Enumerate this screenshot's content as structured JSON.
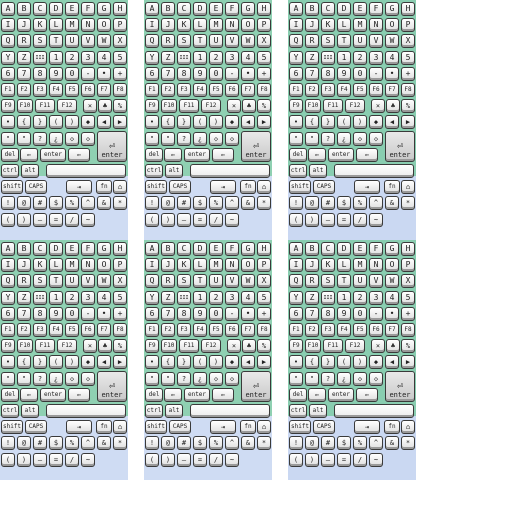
{
  "sheets": [
    {
      "id": "sheet-1",
      "variant": "a"
    },
    {
      "id": "sheet-2",
      "variant": "a"
    },
    {
      "id": "sheet-3",
      "variant": "b"
    },
    {
      "id": "sheet-4",
      "variant": "a"
    },
    {
      "id": "sheet-5",
      "variant": "a"
    },
    {
      "id": "sheet-6",
      "variant": "b"
    }
  ],
  "rows": [
    {
      "name": "letters-a-h",
      "keys": [
        "A",
        "B",
        "C",
        "D",
        "E",
        "F",
        "G",
        "H"
      ]
    },
    {
      "name": "letters-i-p",
      "keys": [
        "I",
        "J",
        "K",
        "L",
        "M",
        "N",
        "O",
        "P"
      ]
    },
    {
      "name": "letters-q-x",
      "keys": [
        "Q",
        "R",
        "S",
        "T",
        "U",
        "V",
        "W",
        "X"
      ]
    },
    {
      "name": "letters-y-z-digits",
      "keys": [
        "Y",
        "Z",
        "III",
        "1",
        "2",
        "3",
        "4",
        "5"
      ]
    },
    {
      "name": "digits-symbols",
      "keys": [
        "6",
        "7",
        "8",
        "9",
        "0",
        "-",
        "•",
        "+"
      ]
    },
    {
      "name": "function-f1-f8",
      "keys": [
        "F1",
        "F2",
        "F3",
        "F4",
        "F5",
        "F6",
        "F7",
        "F8"
      ]
    },
    {
      "name": "function-f9-f12-symbols",
      "keys": [
        "F9",
        "F10",
        "F11",
        "F12",
        "×",
        "♣",
        "%"
      ]
    },
    {
      "name": "brackets-arrows",
      "keys": [
        "•",
        "{",
        "}",
        "(",
        ")",
        "◆",
        "◀",
        "▶"
      ]
    },
    {
      "name": "quotes-punctuation",
      "keys": [
        "\"",
        "\"",
        "?",
        "¿",
        "◇",
        "◇"
      ]
    },
    {
      "name": "editing-keys",
      "keys": [
        "del",
        "⇐",
        "enter",
        "⇐"
      ]
    },
    {
      "name": "modifier-keys",
      "keys": [
        "ctrl",
        "alt"
      ]
    },
    {
      "name": "shift-caps",
      "keys": [
        "shift",
        "CAPS",
        "⇥",
        "fn",
        "⌂"
      ]
    },
    {
      "name": "special-symbols",
      "keys": [
        "!",
        "@",
        "#",
        "$",
        "%",
        "^",
        "&",
        "*"
      ]
    },
    {
      "name": "bottom-symbols",
      "keys": [
        "(",
        ")",
        "—",
        "=",
        "/",
        "~"
      ]
    }
  ],
  "special": {
    "enter_big": "enter",
    "return_icon": "⏎",
    "space_blank": ""
  },
  "colors": {
    "green": "#8fd0b2",
    "blue": "#cfdcf3",
    "key_border": "#3a3a3a"
  }
}
